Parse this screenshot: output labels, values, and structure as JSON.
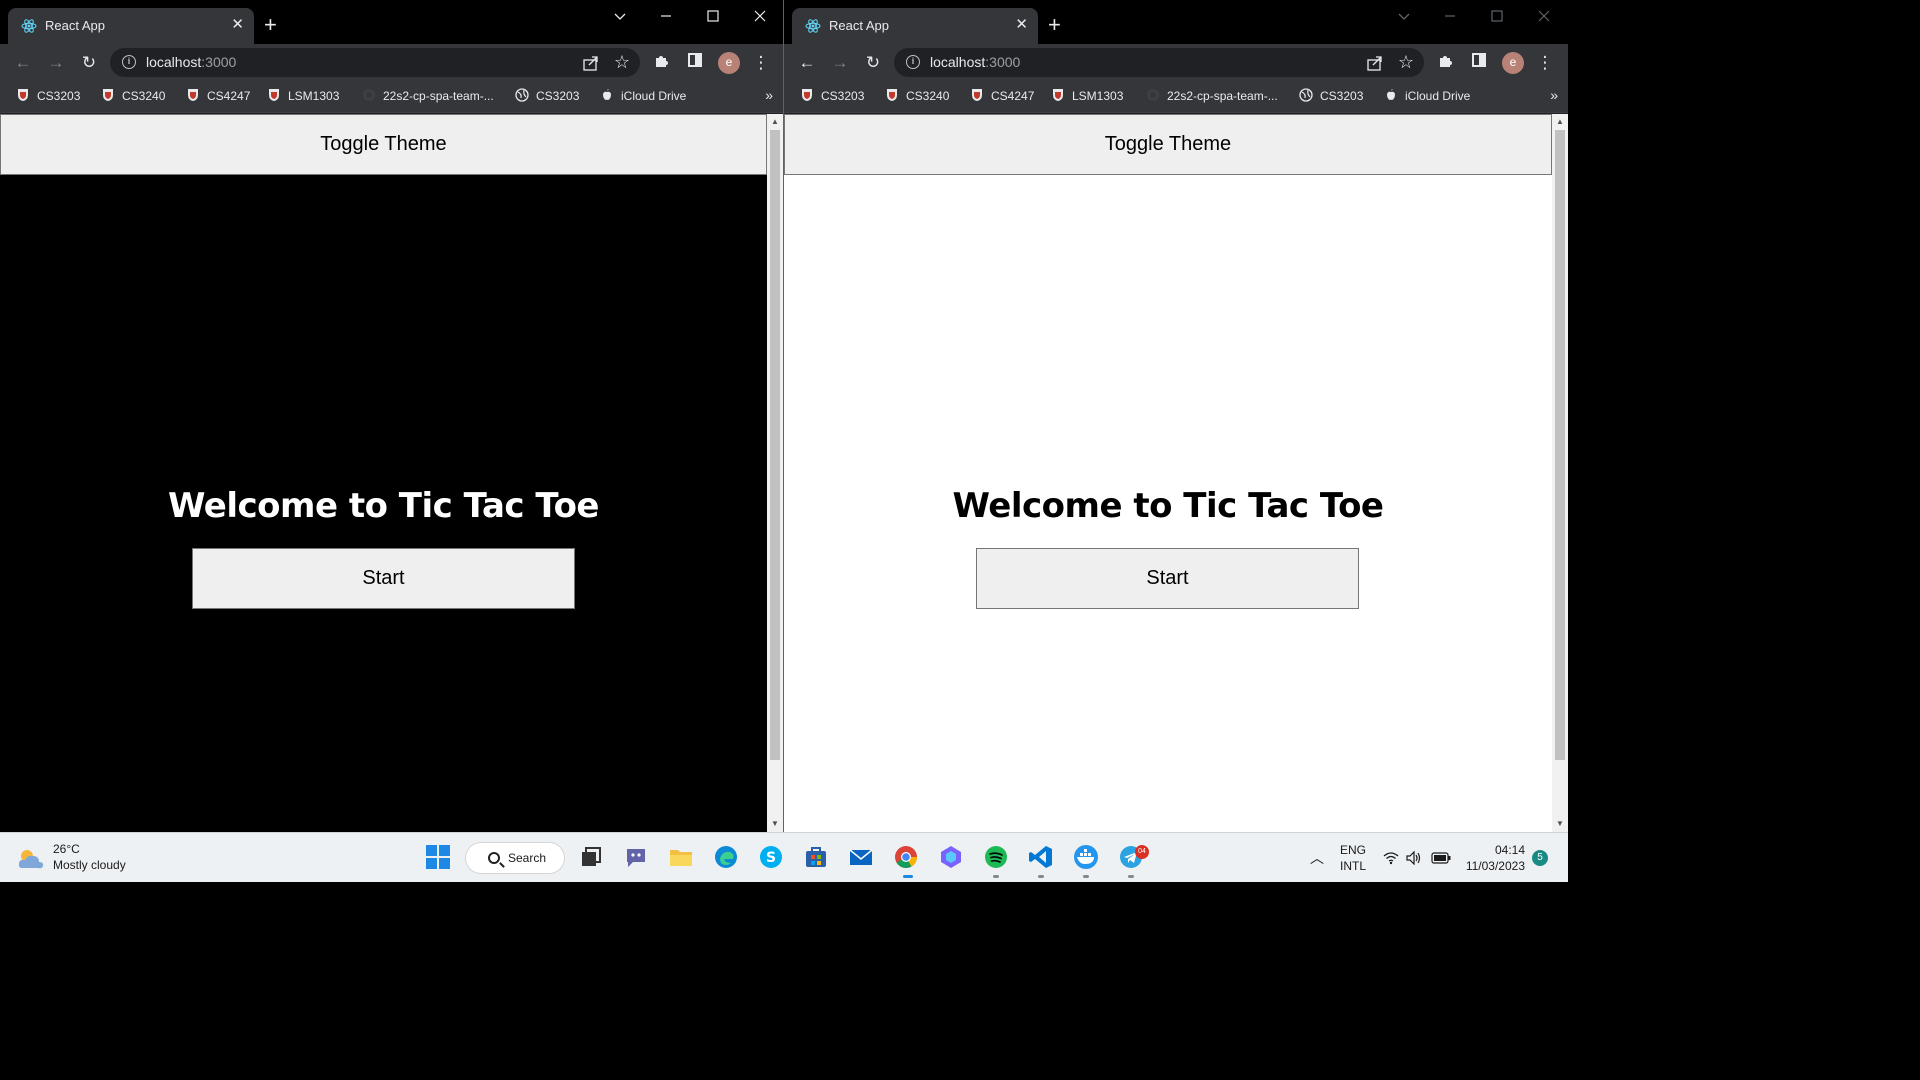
{
  "windows": [
    {
      "tab_title": "React App",
      "url_host": "localhost",
      "url_path": ":3000",
      "profile_initial": "e",
      "bookmarks": [
        "CS3203",
        "CS3240",
        "CS4247",
        "LSM1303",
        "22s2-cp-spa-team-...",
        "CS3203",
        "iCloud Drive"
      ],
      "toggle_label": "Toggle Theme",
      "welcome": "Welcome to Tic Tac Toe",
      "start_label": "Start",
      "theme": "dark",
      "page_bg": "#000000",
      "text_color": "#ffffff"
    },
    {
      "tab_title": "React App",
      "url_host": "localhost",
      "url_path": ":3000",
      "profile_initial": "e",
      "bookmarks": [
        "CS3203",
        "CS3240",
        "CS4247",
        "LSM1303",
        "22s2-cp-spa-team-...",
        "CS3203",
        "iCloud Drive"
      ],
      "toggle_label": "Toggle Theme",
      "welcome": "Welcome to Tic Tac Toe",
      "start_label": "Start",
      "theme": "light",
      "page_bg": "#ffffff",
      "text_color": "#000000"
    }
  ],
  "taskbar": {
    "weather_temp": "26°C",
    "weather_desc": "Mostly cloudy",
    "search_label": "Search",
    "lang_line1": "ENG",
    "lang_line2": "INTL",
    "time": "04:14",
    "date": "11/03/2023",
    "notification_count": "5",
    "telegram_badge": "04",
    "apps": [
      "start-icon",
      "task-view-icon",
      "teams-chat-icon",
      "file-explorer-icon",
      "edge-icon",
      "skype-icon",
      "store-icon",
      "mail-icon",
      "chrome-icon",
      "copilot-icon",
      "spotify-icon",
      "vscode-icon",
      "docker-icon",
      "telegram-icon"
    ]
  }
}
